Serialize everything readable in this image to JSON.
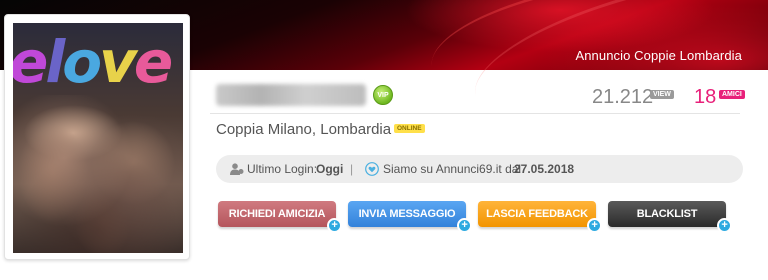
{
  "banner": {
    "title": "Annuncio Coppie Lombardia"
  },
  "profile": {
    "username": "onelove1998",
    "vip_label": "VIP",
    "views": "21.212",
    "views_tag": "VIEW",
    "friends": "18",
    "friends_tag": "AMICI",
    "location": "Coppia Milano, Lombardia",
    "online_label": "ONLINE",
    "photo_logo_text": "elove"
  },
  "info": {
    "login_label": "Ultimo Login:",
    "login_value": "Oggi",
    "separator": "|",
    "since_label": "Siamo su Annunci69.it dal",
    "since_date": "27.05.2018"
  },
  "actions": {
    "friend_request": "RICHIEDI AMICIZIA",
    "send_message": "INVIA MESSAGGIO",
    "leave_feedback": "LASCIA FEEDBACK",
    "blacklist": "BLACKLIST",
    "plus": "+"
  },
  "colors": {
    "accent_pink": "#e8207a",
    "vip_green": "#6fb820",
    "online_yellow": "#ffe04a",
    "plus_blue": "#2eaae0"
  },
  "icons": {
    "user": "user-icon",
    "heart": "heart-shield-icon",
    "plus": "plus-circle-icon"
  }
}
